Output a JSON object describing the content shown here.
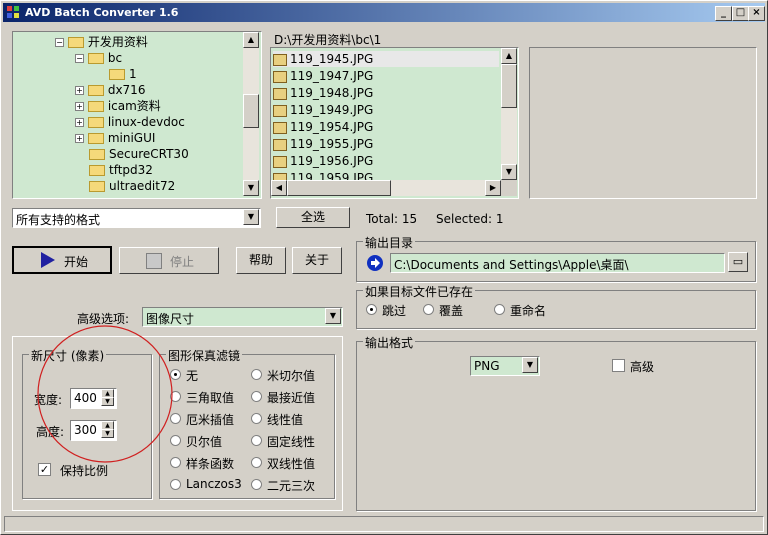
{
  "window": {
    "title": "AVD Batch Converter 1.6"
  },
  "tree": {
    "items": [
      {
        "label": "开发用资料",
        "expander": "⊟"
      },
      {
        "label": "bc",
        "expander": "⊟"
      },
      {
        "label": "1",
        "expander": ""
      },
      {
        "label": "dx716",
        "expander": "+"
      },
      {
        "label": "icam资料",
        "expander": "+"
      },
      {
        "label": "linux-devdoc",
        "expander": "+"
      },
      {
        "label": "miniGUI",
        "expander": "+"
      },
      {
        "label": "SecureCRT30",
        "expander": ""
      },
      {
        "label": "tftpd32",
        "expander": ""
      },
      {
        "label": "ultraedit72",
        "expander": ""
      }
    ]
  },
  "filelist": {
    "path": "D:\\开发用资料\\bc\\1",
    "files": [
      "119_1945.JPG",
      "119_1947.JPG",
      "119_1948.JPG",
      "119_1949.JPG",
      "119_1954.JPG",
      "119_1955.JPG",
      "119_1956.JPG",
      "119_1959.JPG"
    ]
  },
  "format_filter": {
    "value": "所有支持的格式"
  },
  "select_all_label": "全选",
  "total_text": "Total: 15",
  "selected_text": "Selected: 1",
  "buttons": {
    "start": "开始",
    "stop": "停止",
    "help": "帮助",
    "about": "关于"
  },
  "output_dir": {
    "label": "输出目录",
    "value": "C:\\Documents and Settings\\Apple\\桌面\\"
  },
  "exists": {
    "label": "如果目标文件已存在",
    "options": [
      "跳过",
      "覆盖",
      "重命名"
    ],
    "selected": 0
  },
  "advanced": {
    "label": "高级选项:",
    "value": "图像尺寸"
  },
  "size": {
    "label": "新尺寸 (像素)",
    "width_label": "宽度:",
    "width": "400",
    "height_label": "高度:",
    "height": "300",
    "keep_ratio": "保持比例"
  },
  "filter": {
    "label": "图形保真滤镜",
    "options": [
      "无",
      "三角取值",
      "厄米插值",
      "贝尔值",
      "样条函数",
      "Lanczos3",
      "米切尔值",
      "最接近值",
      "线性值",
      "固定线性",
      "双线性值",
      "二元三次"
    ],
    "selected": 0
  },
  "output_format": {
    "label": "输出格式",
    "value": "PNG",
    "advanced": "高级"
  },
  "colors": {
    "title_start": "#0a246a",
    "title_end": "#a6caf0",
    "list_bg": "#cfe8d0",
    "annotation": "#d02020"
  }
}
